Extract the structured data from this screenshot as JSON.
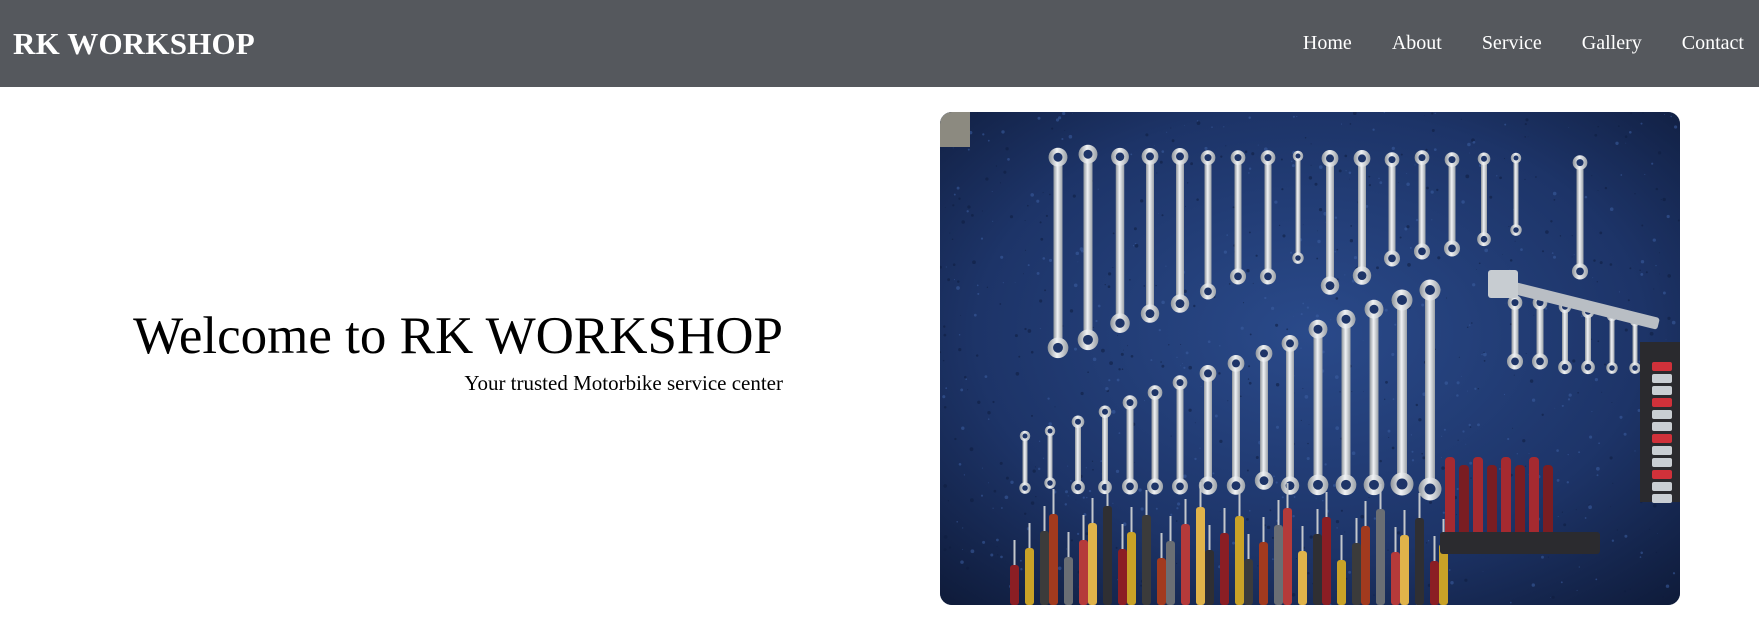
{
  "header": {
    "brand": "RK WORKSHOP",
    "nav": [
      {
        "label": "Home"
      },
      {
        "label": "About"
      },
      {
        "label": "Service"
      },
      {
        "label": "Gallery"
      },
      {
        "label": "Contact"
      }
    ]
  },
  "hero": {
    "title": "Welcome to RK WORKSHOP",
    "subtitle": "Your trusted Motorbike service center"
  },
  "colors": {
    "header_bg": "#55585d",
    "header_text": "#ffffff",
    "page_bg": "#ffffff"
  },
  "icons": {
    "hero_image": "wrench-wall-photo"
  }
}
